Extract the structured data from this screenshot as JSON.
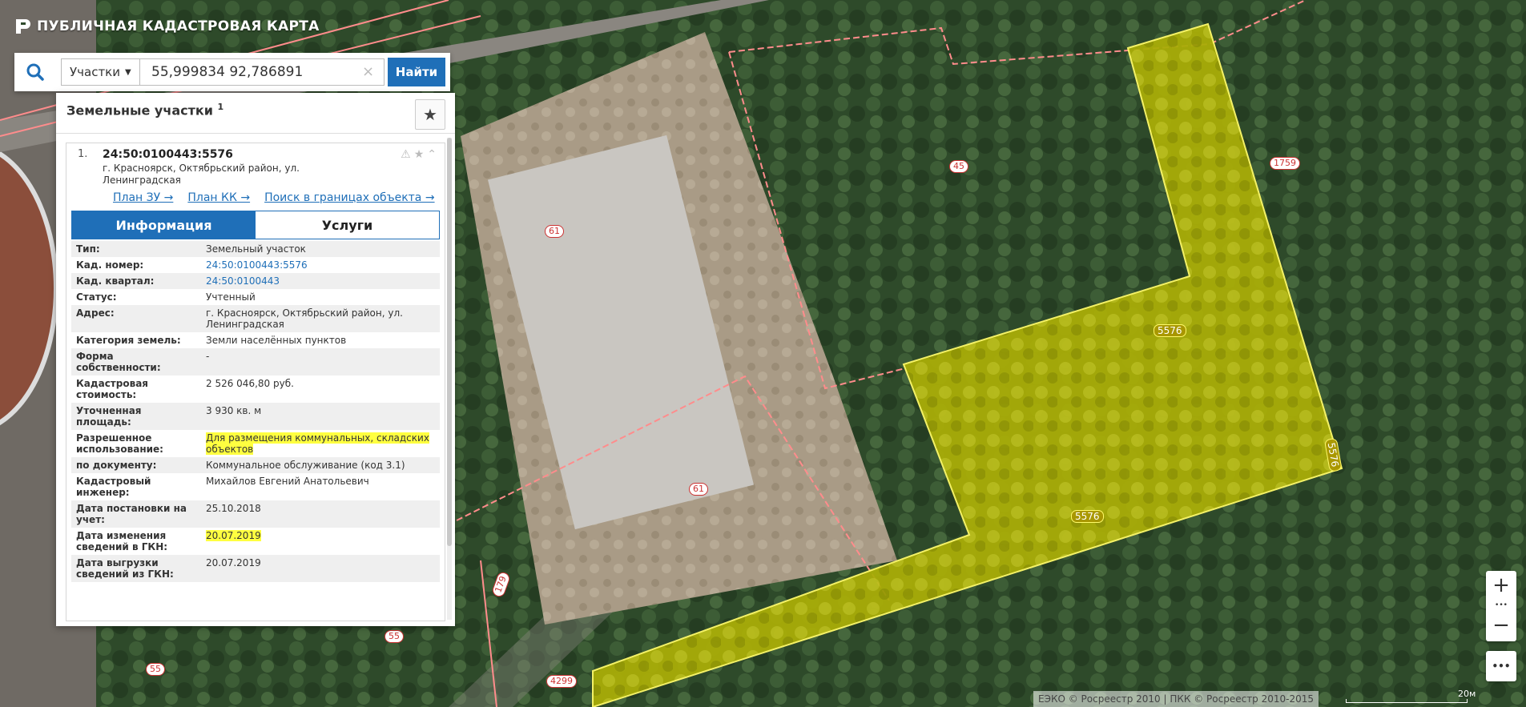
{
  "app": {
    "title": "ПУБЛИЧНАЯ КАДАСТРОВАЯ КАРТА"
  },
  "search": {
    "type_label": "Участки",
    "query": "55,999834 92,786891",
    "clear_label": "×",
    "submit_label": "Найти"
  },
  "results": {
    "title": "Земельные участки",
    "count": "1",
    "item": {
      "index": "1.",
      "cad_number": "24:50:0100443:5576",
      "address": "г. Красноярск, Октябрьский район, ул. Ленинградская",
      "links": [
        "План ЗУ →",
        "План КК →",
        "Поиск в границах объекта →"
      ],
      "tabs": [
        "Информация",
        "Услуги"
      ],
      "fields": [
        {
          "key": "Тип:",
          "value": "Земельный участок"
        },
        {
          "key": "Кад. номер:",
          "value": "24:50:0100443:5576"
        },
        {
          "key": "Кад. квартал:",
          "value": "24:50:0100443"
        },
        {
          "key": "Статус:",
          "value": "Учтенный"
        },
        {
          "key": "Адрес:",
          "value": "г. Красноярск, Октябрьский район, ул. Ленинградская"
        },
        {
          "key": "Категория земель:",
          "value": "Земли населённых пунктов"
        },
        {
          "key": "Форма собственности:",
          "value": "-"
        },
        {
          "key": "Кадастровая стоимость:",
          "value": "2 526 046,80 руб."
        },
        {
          "key": "Уточненная площадь:",
          "value": "3 930 кв. м"
        },
        {
          "key": "Разрешенное использование:",
          "value": "Для размещения коммунальных, складских объектов"
        },
        {
          "key": "по документу:",
          "value": "Коммунальное обслуживание (код 3.1)"
        },
        {
          "key": "Кадастровый инженер:",
          "value": "Михайлов Евгений Анатольевич"
        },
        {
          "key": "Дата постановки на учет:",
          "value": "25.10.2018"
        },
        {
          "key": "Дата изменения сведений в ГКН:",
          "value": "20.07.2019"
        },
        {
          "key": "Дата выгрузки сведений из ГКН:",
          "value": "20.07.2019"
        }
      ]
    }
  },
  "map": {
    "labels": [
      "45",
      "1759",
      "5576",
      "5576",
      "5576",
      "61",
      "61",
      "55",
      "55",
      "179",
      "4299"
    ],
    "zoom_in": "+",
    "zoom_out": "−",
    "more": "•••",
    "attribution": "ЕЭКО © Росреестр 2010 | ПКК © Росреестр 2010-2015",
    "scale": "20м"
  },
  "colors": {
    "accent": "#1f6fb8",
    "highlight": "#ffff40",
    "parcel": "#b5b800"
  }
}
